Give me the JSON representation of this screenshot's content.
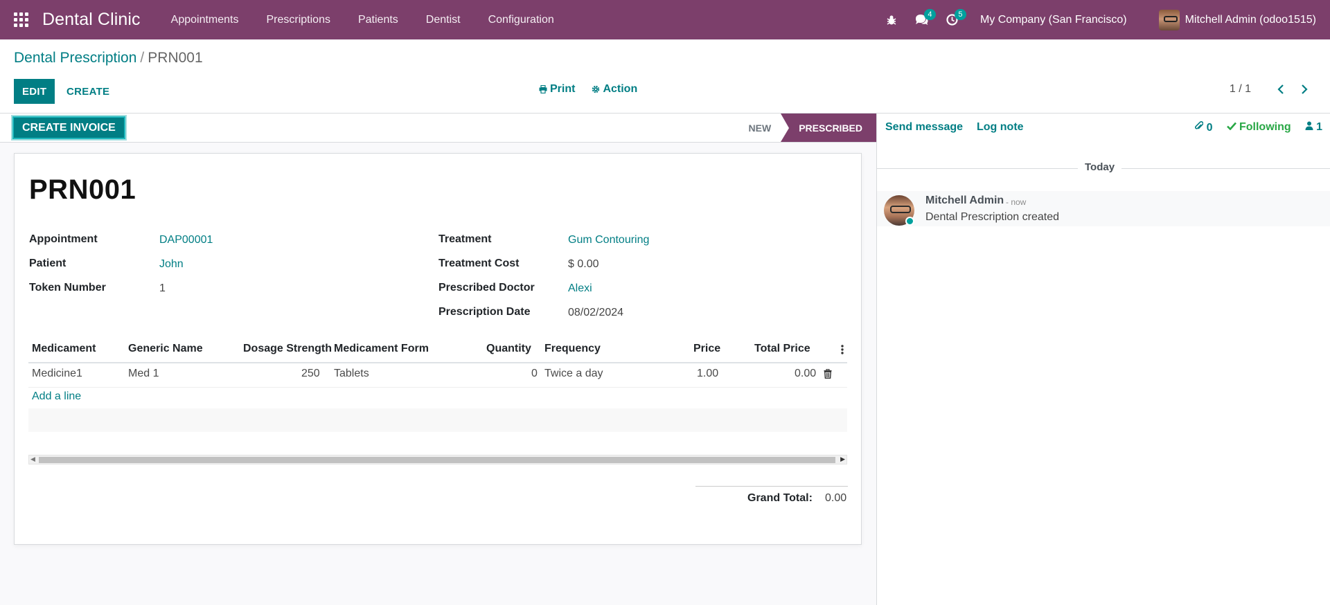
{
  "navbar": {
    "brand": "Dental Clinic",
    "menu": [
      "Appointments",
      "Prescriptions",
      "Patients",
      "Dentist",
      "Configuration"
    ],
    "messages_count": "4",
    "activities_count": "5",
    "company": "My Company (San Francisco)",
    "user": "Mitchell Admin (odoo1515)"
  },
  "control": {
    "breadcrumb_parent": "Dental Prescription",
    "breadcrumb_sep": "/",
    "breadcrumb_current": "PRN001",
    "edit_label": "EDIT",
    "create_label": "CREATE",
    "print_label": "Print",
    "action_label": "Action",
    "pager_value": "1 / 1"
  },
  "statusbar": {
    "create_invoice_label": "CREATE INVOICE",
    "stage_new": "NEW",
    "stage_prescribed": "PRESCRIBED",
    "active_color": "#7c3f6b"
  },
  "form": {
    "name": "PRN001",
    "left_fields": [
      {
        "label": "Appointment",
        "value": "DAP00001"
      },
      {
        "label": "Patient",
        "value": "John"
      },
      {
        "label": "Token Number",
        "value": "1"
      }
    ],
    "right_fields": [
      {
        "label": "Treatment",
        "value": "Gum Contouring"
      },
      {
        "label": "Treatment Cost",
        "value": "$ 0.00"
      },
      {
        "label": "Prescribed Doctor",
        "value": "Alexi"
      },
      {
        "label": "Prescription Date",
        "value": "08/02/2024"
      }
    ],
    "table": {
      "headers": [
        "Medicament",
        "Generic Name",
        "Dosage Strength",
        "Medicament Form",
        "Quantity",
        "Frequency",
        "Price",
        "Total Price"
      ],
      "rows": [
        [
          "Medicine1",
          "Med 1",
          "250",
          "Tablets",
          "0",
          "Twice a day",
          "1.00",
          "0.00"
        ]
      ],
      "add_line_label": "Add a line"
    },
    "grand_total_label": "Grand Total:",
    "grand_total_value": "0.00"
  },
  "chatter": {
    "send_message_label": "Send message",
    "log_note_label": "Log note",
    "attachments_count": "0",
    "following_label": "Following",
    "followers_count": "1",
    "date_separator": "Today",
    "messages": [
      {
        "author": "Mitchell Admin",
        "when": "- now",
        "body": "Dental Prescription created"
      }
    ]
  },
  "colors": {
    "brand": "#7c3f6b",
    "primary": "#017e84",
    "success": "#28a745"
  }
}
